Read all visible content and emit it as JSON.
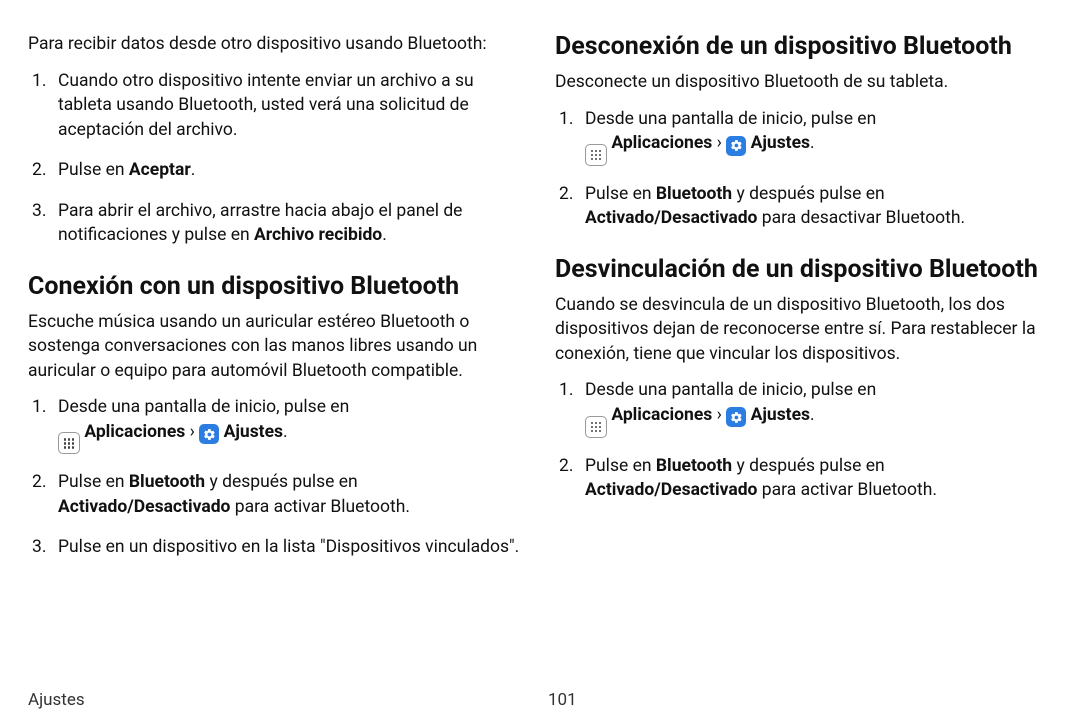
{
  "left": {
    "intro": "Para recibir datos desde otro dispositivo usando Bluetooth:",
    "steps_a": {
      "1": {
        "text": "Cuando otro dispositivo intente enviar un archivo a su tableta usando Bluetooth, usted verá una solicitud de aceptación del archivo."
      },
      "2": {
        "pre": "Pulse en ",
        "bold": "Aceptar",
        "post": "."
      },
      "3": {
        "pre": "Para abrir el archivo, arrastre hacia abajo el panel de notificaciones y pulse en ",
        "bold": "Archivo recibido",
        "post": "."
      }
    },
    "h_connect": "Conexión con un dispositivo Bluetooth",
    "connect_para": "Escuche música usando un auricular estéreo Bluetooth o sostenga conversaciones con las manos libres usando un auricular o equipo para automóvil Bluetooth compatible.",
    "steps_b": {
      "1": {
        "pre": "Desde una pantalla de inicio, pulse en",
        "apps_label": "Aplicaciones",
        "sep": " › ",
        "settings_label": "Ajustes",
        "post": "."
      },
      "2": {
        "p1": "Pulse en ",
        "b1": "Bluetooth",
        "p2": " y después pulse en ",
        "b2": "Activado/Desactivado",
        "p3": " para activar Bluetooth."
      },
      "3": {
        "text": "Pulse en un dispositivo en la lista \"Dispositivos vinculados\"."
      }
    }
  },
  "right": {
    "h_disconnect": "Desconexión de un dispositivo Bluetooth",
    "disconnect_para": "Desconecte un dispositivo Bluetooth de su tableta.",
    "steps_c": {
      "1": {
        "pre": "Desde una pantalla de inicio, pulse en",
        "apps_label": "Aplicaciones",
        "sep": " › ",
        "settings_label": "Ajustes",
        "post": "."
      },
      "2": {
        "p1": "Pulse en ",
        "b1": "Bluetooth",
        "p2": " y después pulse en ",
        "b2": "Activado/Desactivado",
        "p3": " para desactivar Bluetooth."
      }
    },
    "h_unpair": "Desvinculación de un dispositivo Bluetooth",
    "unpair_para": "Cuando se desvincula de un dispositivo Bluetooth, los dos dispositivos dejan de reconocerse entre sí. Para restablecer la conexión, tiene que vincular los dispositivos.",
    "steps_d": {
      "1": {
        "pre": "Desde una pantalla de inicio, pulse en",
        "apps_label": "Aplicaciones",
        "sep": " › ",
        "settings_label": "Ajustes",
        "post": "."
      },
      "2": {
        "p1": "Pulse en ",
        "b1": "Bluetooth",
        "p2": " y después pulse en ",
        "b2": "Activado/Desactivado",
        "p3": " para activar Bluetooth."
      }
    }
  },
  "footer": {
    "section": "Ajustes",
    "page": "101"
  }
}
